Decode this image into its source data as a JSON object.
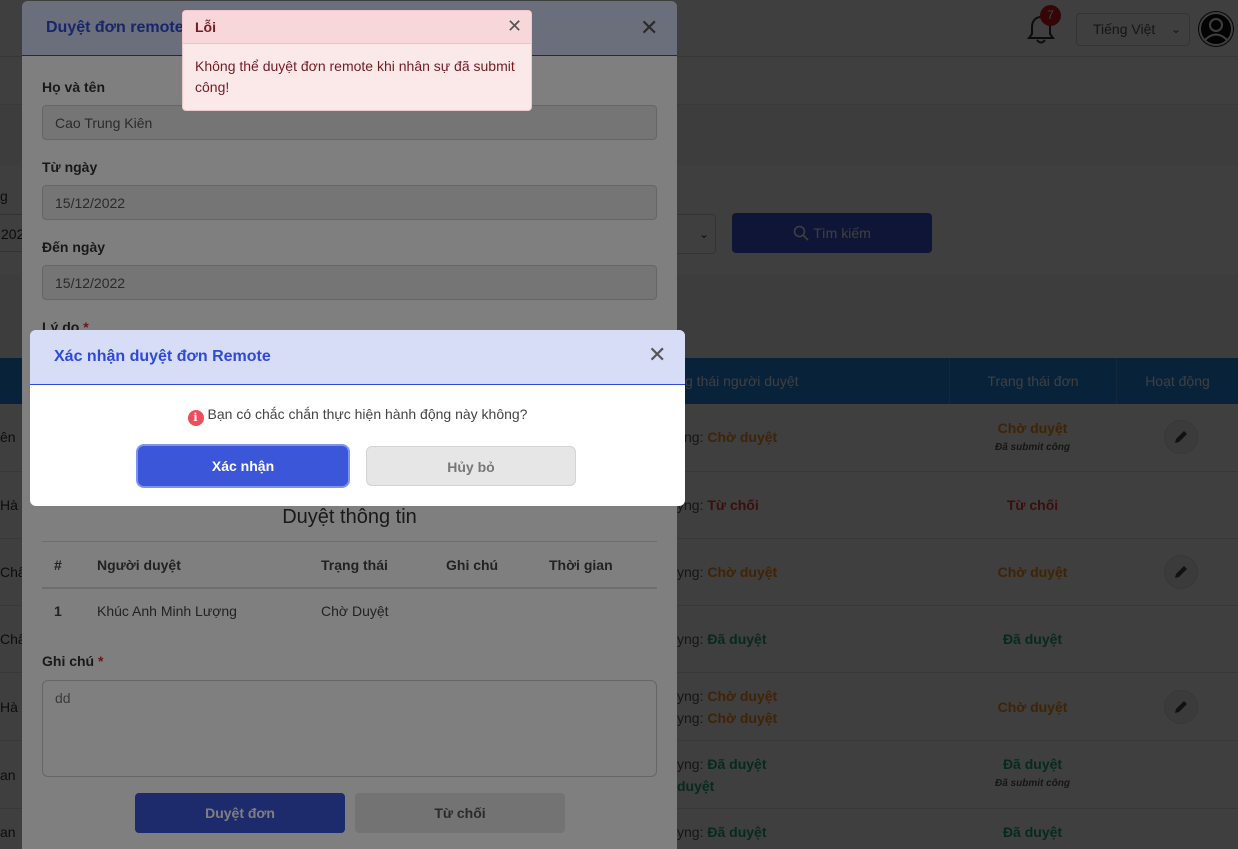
{
  "header": {
    "notification_count": "7",
    "language": "Tiếng Việt"
  },
  "filters": {
    "label": "g",
    "date_value": "202",
    "search_label": "Tìm kiếm"
  },
  "table": {
    "headers": {
      "approver_status": "g thái người duyệt",
      "request_status": "Trạng thái đơn",
      "action": "Hoạt động"
    },
    "rows": [
      {
        "name": "ên",
        "appr_prefix": "yng:",
        "appr_status": "Chờ duyệt",
        "appr_prefix2": "",
        "appr_status2": "",
        "status": "Chờ duyệt",
        "note": "Đã submit công"
      },
      {
        "name": "Hà",
        "appr_prefix": "yng:",
        "appr_status": "Từ chối",
        "appr_prefix2": "",
        "appr_status2": "",
        "status": "Từ chối",
        "note": ""
      },
      {
        "name": "Châu",
        "appr_prefix": "yng:",
        "appr_status": "Chờ duyệt",
        "appr_prefix2": "",
        "appr_status2": "",
        "status": "Chờ duyệt",
        "note": ""
      },
      {
        "name": "Châu",
        "appr_prefix": "yng:",
        "appr_status": "Đã duyệt",
        "appr_prefix2": "",
        "appr_status2": "",
        "status": "Đã duyệt",
        "note": ""
      },
      {
        "name": "Hà",
        "appr_prefix": "yng:",
        "appr_status": "Chờ duyệt",
        "appr_prefix2": "yng:",
        "appr_status2": "Chờ duyệt",
        "status": "Chờ duyệt",
        "note": ""
      },
      {
        "name": "an",
        "appr_prefix": "yng:",
        "appr_status": "Đã duyệt",
        "appr_prefix2": "",
        "appr_status2": "duyệt",
        "status": "Đã duyệt",
        "note": "Đã submit công"
      },
      {
        "name": "an",
        "appr_prefix": "yng:",
        "appr_status": "Đã duyệt",
        "appr_prefix2": "",
        "appr_status2": "",
        "status": "Đã duyệt",
        "note": ""
      }
    ]
  },
  "remote_modal": {
    "title": "Duyệt đơn remote",
    "full_name_label": "Họ và tên",
    "full_name_value": "Cao Trung Kiên",
    "from_label": "Từ ngày",
    "from_value": "15/12/2022",
    "to_label": "Đến ngày",
    "to_value": "15/12/2022",
    "reason_label": "Lý do",
    "approval_title": "Duyệt thông tin",
    "approval_headers": {
      "num": "#",
      "approver": "Người duyệt",
      "status": "Trạng thái",
      "note": "Ghi chú",
      "time": "Thời gian"
    },
    "approval_rows": [
      {
        "num": "1",
        "approver": "Khúc Anh Minh Lượng",
        "status": "Chờ Duyệt",
        "note": "",
        "time": ""
      }
    ],
    "note_label": "Ghi chú",
    "note_value": "dd",
    "approve_button": "Duyệt đơn",
    "reject_button": "Từ chối",
    "required_mark": "*"
  },
  "confirm_modal": {
    "title": "Xác nhận duyệt đơn Remote",
    "message": "Bạn có chắc chắn thực hiện hành động này không?",
    "confirm_button": "Xác nhận",
    "cancel_button": "Hủy bỏ",
    "info_glyph": "i"
  },
  "toast": {
    "title": "Lỗi",
    "message": "Không thể duyệt đơn remote khi nhân sự đã submit công!"
  },
  "colors": {
    "primary": "#3b56d9",
    "header_bg": "#d7dcf7",
    "table_head": "#1e88e5",
    "pending": "#ff8c1a",
    "rejected": "#e53935",
    "approved": "#19a974",
    "error_bg": "#f8d7da"
  }
}
